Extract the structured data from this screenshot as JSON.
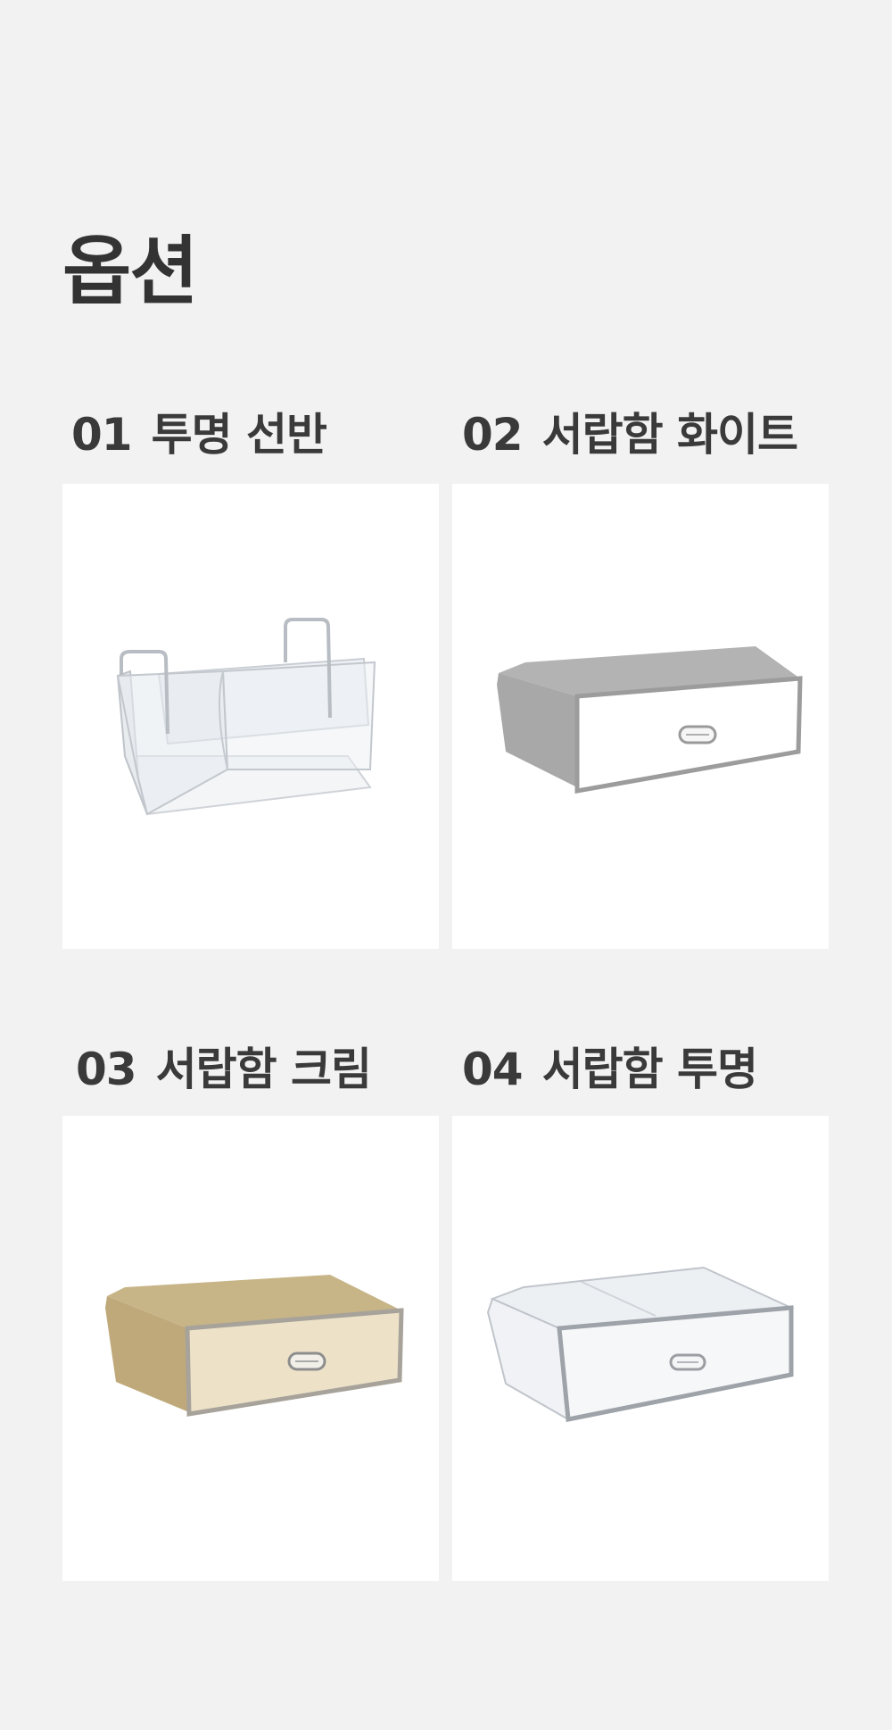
{
  "page": {
    "title": "옵션",
    "background": "#f2f2f2"
  },
  "options": [
    {
      "number": "01",
      "name": "투명 선반"
    },
    {
      "number": "02",
      "name": "서랍함 화이트"
    },
    {
      "number": "03",
      "name": "서랍함 크림"
    },
    {
      "number": "04",
      "name": "서랍함 투명"
    }
  ]
}
